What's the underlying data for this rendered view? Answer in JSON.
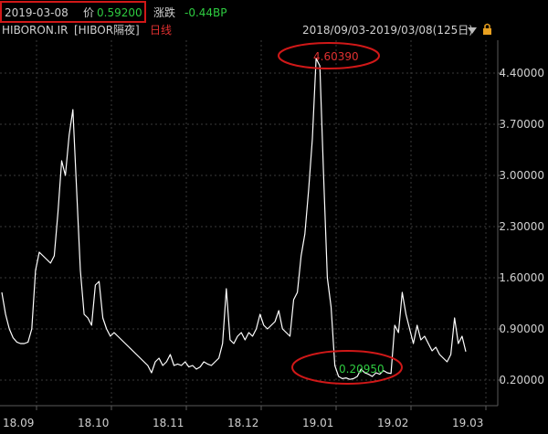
{
  "header": {
    "date": "2019-03-08",
    "price_label": "价",
    "price_value": "0.59200",
    "change_label": "涨跌",
    "change_value": "-0.44BP"
  },
  "subheader": {
    "symbol": "HIBORON.IR",
    "name": "[HIBOR隔夜]",
    "period": "日线",
    "date_range": "2018/09/03-2019/03/08(125日)"
  },
  "annotations": {
    "max_label": "4.60390",
    "min_label": "0.20950"
  },
  "colors": {
    "background": "#000000",
    "line": "#ffffff",
    "grid": "#3a3a3a",
    "axis_text": "#d0d0d0",
    "price_green": "#2ecc40",
    "label_red": "#e03030",
    "ellipse_red": "#d01818",
    "lock_orange": "#e8a020"
  },
  "icons": {
    "dropdown": "triangle-down-icon",
    "lock": "lock-icon"
  },
  "chart_data": {
    "type": "line",
    "title": "",
    "xlabel": "",
    "ylabel": "",
    "x_ticks": [
      "18.09",
      "18.10",
      "18.11",
      "18.12",
      "19.01",
      "19.02",
      "19.03"
    ],
    "y_ticks": [
      "0.20000",
      "0.90000",
      "1.60000",
      "2.30000",
      "3.00000",
      "3.70000",
      "4.40000"
    ],
    "ylim": [
      -0.15,
      4.85
    ],
    "grid": true,
    "series": [
      {
        "name": "",
        "values": [
          1.4,
          1.1,
          0.9,
          0.78,
          0.72,
          0.7,
          0.7,
          0.72,
          0.9,
          1.7,
          1.95,
          1.9,
          1.85,
          1.8,
          1.9,
          2.5,
          3.2,
          3.0,
          3.55,
          3.9,
          2.8,
          1.7,
          1.1,
          1.05,
          0.95,
          1.5,
          1.55,
          1.05,
          0.9,
          0.8,
          0.85,
          0.8,
          0.75,
          0.7,
          0.65,
          0.6,
          0.55,
          0.5,
          0.45,
          0.4,
          0.3,
          0.45,
          0.5,
          0.4,
          0.45,
          0.55,
          0.4,
          0.42,
          0.4,
          0.45,
          0.38,
          0.4,
          0.35,
          0.38,
          0.45,
          0.42,
          0.4,
          0.45,
          0.5,
          0.7,
          1.45,
          0.75,
          0.7,
          0.8,
          0.85,
          0.75,
          0.85,
          0.8,
          0.9,
          1.1,
          0.95,
          0.9,
          0.95,
          1.0,
          1.15,
          0.9,
          0.85,
          0.8,
          1.3,
          1.4,
          1.9,
          2.2,
          2.8,
          3.5,
          4.6,
          4.5,
          3.0,
          1.6,
          1.2,
          0.4,
          0.25,
          0.22,
          0.23,
          0.21,
          0.22,
          0.25,
          0.35,
          0.3,
          0.28,
          0.25,
          0.3,
          0.28,
          0.33,
          0.3,
          0.29,
          0.95,
          0.85,
          1.4,
          1.1,
          0.9,
          0.7,
          0.95,
          0.75,
          0.8,
          0.7,
          0.6,
          0.65,
          0.55,
          0.5,
          0.45,
          0.55,
          1.05,
          0.7,
          0.8,
          0.59
        ]
      }
    ]
  }
}
